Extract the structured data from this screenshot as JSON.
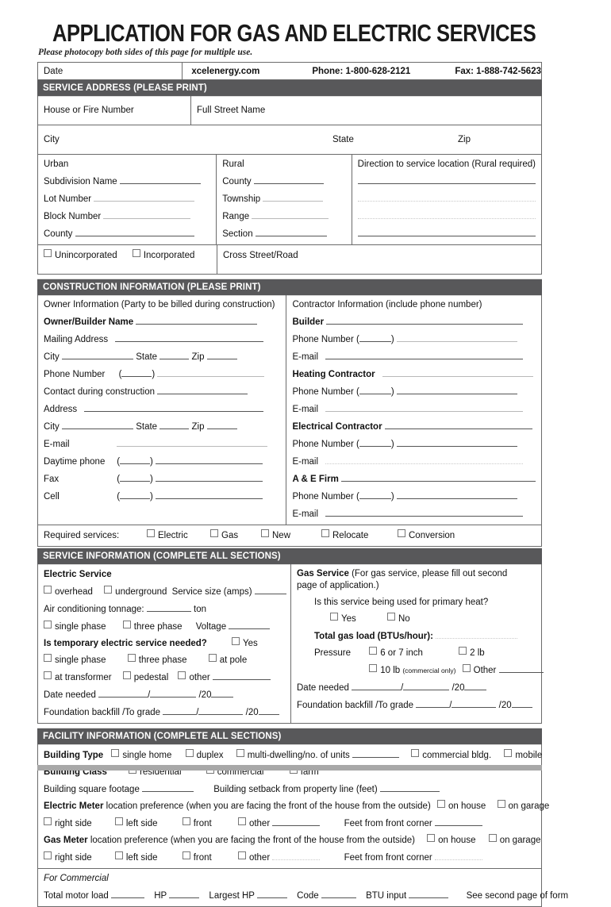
{
  "header": {
    "title": "APPLICATION FOR GAS AND ELECTRIC SERVICES",
    "subtitle": "Please photocopy both sides of this page for multiple use.",
    "date_label": "Date",
    "website": "xcelenergy.com",
    "phone": "Phone: 1-800-628-2121",
    "fax": "Fax: 1-888-742-5623"
  },
  "service_address": {
    "band": "SERVICE ADDRESS (PLEASE PRINT)",
    "house_or_fire_number": "House or Fire Number",
    "full_street_name": "Full Street Name",
    "city": "City",
    "state": "State",
    "zip": "Zip",
    "urban": {
      "heading": "Urban",
      "subdivision_name": "Subdivision Name",
      "lot_number": "Lot Number",
      "block_number": "Block Number",
      "county": "County"
    },
    "rural": {
      "heading": "Rural",
      "county": "County",
      "township": "Township",
      "range": "Range",
      "section": "Section"
    },
    "direction_heading": "Direction to service location (Rural required)",
    "unincorporated": "Unincorporated",
    "incorporated": "Incorporated",
    "cross_street": "Cross Street/Road"
  },
  "construction": {
    "band": "CONSTRUCTION INFORMATION (PLEASE PRINT)",
    "owner": {
      "heading": "Owner Information (Party to be billed during construction)",
      "owner_builder_name": "Owner/Builder Name",
      "mailing_address": "Mailing Address",
      "city": "City",
      "state": "State",
      "zip": "Zip",
      "phone_number": "Phone Number",
      "contact_during_construction": "Contact during construction",
      "address": "Address",
      "city2": "City",
      "state2": "State",
      "zip2": "Zip",
      "email": "E-mail",
      "daytime_phone": "Daytime phone",
      "fax": "Fax",
      "cell": "Cell"
    },
    "contractor": {
      "heading": "Contractor Information (include phone number)",
      "builder": "Builder",
      "builder_phone": "Phone Number (",
      "builder_email": "E-mail",
      "heating_contractor": "Heating Contractor",
      "heating_phone": "Phone Number (",
      "heating_email": "E-mail",
      "electrical_contractor": "Electrical Contractor",
      "electrical_phone": "Phone Number (",
      "electrical_email": "E-mail",
      "ae_firm": "A & E Firm",
      "ae_phone": "Phone Number (",
      "ae_email": "E-mail"
    },
    "required_services": {
      "label": "Required services:",
      "options": [
        "Electric",
        "Gas",
        "New",
        "Relocate",
        "Conversion"
      ]
    }
  },
  "service_information": {
    "band": "SERVICE INFORMATION (COMPLETE ALL SECTIONS)",
    "electric": {
      "heading": "Electric Service",
      "overhead": "overhead",
      "underground": "underground",
      "service_size": "Service size (amps)",
      "air_conditioning": "Air conditioning tonnage:",
      "ton": "ton",
      "single_phase": "single phase",
      "three_phase": "three phase",
      "voltage": "Voltage",
      "temp_question": "Is temporary electric service needed?",
      "yes": "Yes",
      "temp_single_phase": "single phase",
      "temp_three_phase": "three phase",
      "at_pole": "at pole",
      "at_transformer": "at transformer",
      "pedestal": "pedestal",
      "other": "other",
      "date_needed": "Date needed",
      "date_suffix": "/20",
      "foundation": "Foundation backfill /To grade",
      "foundation_suffix": "/20"
    },
    "gas": {
      "heading": "Gas Service",
      "heading_note": "(For gas service, please fill out second page of application.)",
      "primary_heat_question": "Is this service being used for primary heat?",
      "yes": "Yes",
      "no": "No",
      "total_gas_load": "Total gas load (BTUs/hour):",
      "pressure": "Pressure",
      "p_6or7": "6 or 7 inch",
      "p_2lb": "2 lb",
      "p_10lb": "10 lb",
      "p_10lb_note": "(commercial only)",
      "p_other": "Other",
      "date_needed": "Date needed",
      "date_suffix": "/20",
      "foundation": "Foundation backfill /To grade",
      "foundation_suffix": "/20"
    }
  },
  "facility_information": {
    "band": "FACILITY INFORMATION (COMPLETE ALL SECTIONS)",
    "building_type_label": "Building Type",
    "building_type_options": [
      "single home",
      "duplex",
      "multi-dwelling/no. of units",
      "commercial bldg.",
      "mobile"
    ],
    "building_class_label": "Building Class",
    "building_class_options": [
      "residential",
      "commercial",
      "farm"
    ],
    "square_footage": "Building square footage",
    "setback": "Building setback from property line (feet)",
    "electric_meter_label": "Electric Meter",
    "electric_meter_text": "location preference (when you are facing the front of the house from the outside)",
    "gas_meter_label": "Gas Meter",
    "gas_meter_text": "location preference (when you are facing the front of the house from the outside)",
    "on_house": "on house",
    "on_garage": "on garage",
    "side_options": [
      "right side",
      "left side",
      "front",
      "other"
    ],
    "feet_from_corner": "Feet from front corner",
    "for_commercial": "For Commercial",
    "total_motor_load": "Total motor load",
    "hp": "HP",
    "largest_hp": "Largest HP",
    "code": "Code",
    "btu_input": "BTU input",
    "see_second_page": "See second page of form"
  }
}
